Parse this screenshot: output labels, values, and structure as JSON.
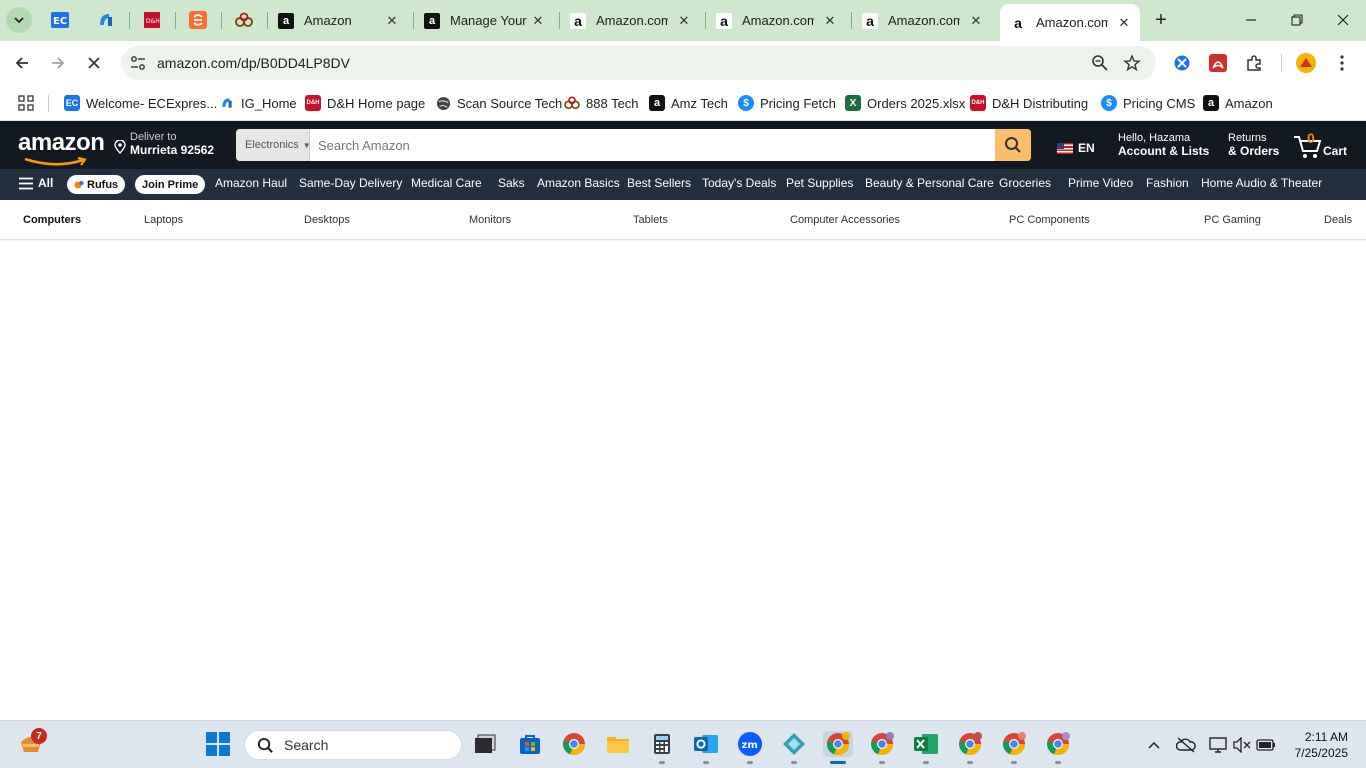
{
  "browser": {
    "tabs": [
      {
        "title": "Amazon",
        "icon": "amazon-icon"
      },
      {
        "title": "Manage Your",
        "icon": "amazon-icon"
      },
      {
        "title": "Amazon.com:",
        "icon": "amazon-smile-icon"
      },
      {
        "title": "Amazon.com:",
        "icon": "amazon-smile-icon"
      },
      {
        "title": "Amazon.com:",
        "icon": "amazon-smile-icon"
      },
      {
        "title": "Amazon.com:",
        "icon": "amazon-smile-icon",
        "active": true
      }
    ],
    "pinned_tabs": [
      "ec-icon",
      "tech-icon",
      "dh-icon",
      "scribe-icon",
      "888-icon"
    ],
    "url": "amazon.com/dp/B0DD4LP8DV",
    "bookmarks": [
      {
        "label": "Welcome- ECExpres...",
        "color": "#1a73e8",
        "text": "EC"
      },
      {
        "label": "IG_Home",
        "color": "#1e88e5",
        "text": ""
      },
      {
        "label": "D&H Home page",
        "color": "#c8102e",
        "text": "D&H"
      },
      {
        "label": "Scan Source Tech",
        "color": "#444444",
        "text": ""
      },
      {
        "label": "888 Tech",
        "color": "#7b3f00",
        "text": ""
      },
      {
        "label": "Amz Tech",
        "color": "#111111",
        "text": "a"
      },
      {
        "label": "Pricing Fetch",
        "color": "#1a8cff",
        "text": "$"
      },
      {
        "label": "Orders 2025.xlsx",
        "color": "#1d6f42",
        "text": "X"
      },
      {
        "label": "D&H Distributing",
        "color": "#c8102e",
        "text": "D&H"
      },
      {
        "label": "Pricing CMS",
        "color": "#1a8cff",
        "text": "$"
      },
      {
        "label": "Amazon",
        "color": "#111111",
        "text": "a"
      }
    ]
  },
  "amazon": {
    "logo": "amazon",
    "deliver_line1": "Deliver to",
    "deliver_line2": "Murrieta 92562",
    "search_category": "Electronics",
    "search_placeholder": "Search Amazon",
    "lang": "EN",
    "account_line1": "Hello, Hazama",
    "account_line2": "Account & Lists",
    "returns_line1": "Returns",
    "returns_line2": "& Orders",
    "cart_count": "0",
    "cart_label": "Cart",
    "nav_all": "All",
    "nav_rufus": "Rufus",
    "nav_join_prime": "Join Prime",
    "nav_items": [
      "Amazon Haul",
      "Same-Day Delivery",
      "Medical Care",
      "Saks",
      "Amazon Basics",
      "Best Sellers",
      "Today's Deals",
      "Pet Supplies",
      "Beauty & Personal Care",
      "Groceries",
      "Prime Video",
      "Fashion",
      "Home Audio & Theater"
    ],
    "sub_items": [
      "Computers",
      "Laptops",
      "Desktops",
      "Monitors",
      "Tablets",
      "Computer Accessories",
      "PC Components",
      "PC Gaming",
      "Deals"
    ]
  },
  "taskbar": {
    "notification_count": "7",
    "search_label": "Search",
    "time": "2:11 AM",
    "date": "7/25/2025"
  },
  "colors": {
    "amazon_dark": "#131921",
    "amazon_nav": "#232f3e",
    "amazon_search_btn": "#febd69",
    "amazon_cart_count": "#f08804",
    "chrome_tabstrip": "#cfe8cd"
  }
}
